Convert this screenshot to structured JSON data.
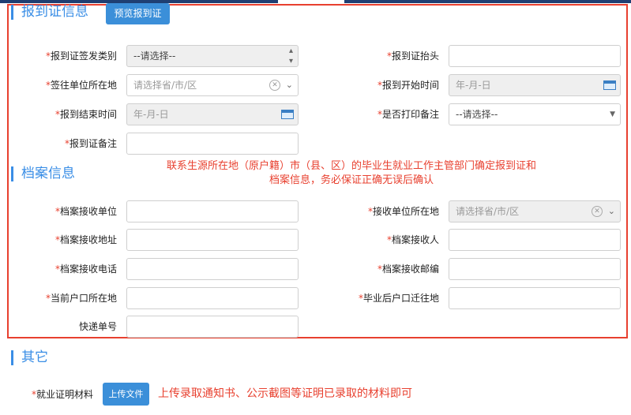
{
  "section1": {
    "title": "报到证信息",
    "preview_button": "预览报到证"
  },
  "section2": {
    "title": "档案信息"
  },
  "section3": {
    "title": "其它"
  },
  "fields": {
    "issue_type": {
      "label": "报到证签发类别",
      "value": "--请选择--"
    },
    "header": {
      "label": "报到证抬头",
      "value": ""
    },
    "unit_location": {
      "label": "签往单位所在地",
      "placeholder": "请选择省/市/区"
    },
    "start_time": {
      "label": "报到开始时间",
      "placeholder": "年-月-日"
    },
    "end_time": {
      "label": "报到结束时间",
      "placeholder": "年-月-日"
    },
    "print_note": {
      "label": "是否打印备注",
      "value": "--请选择--"
    },
    "remark": {
      "label": "报到证备注",
      "value": ""
    },
    "archive_unit": {
      "label": "档案接收单位",
      "value": ""
    },
    "receive_unit_location": {
      "label": "接收单位所在地",
      "placeholder": "请选择省/市/区"
    },
    "archive_address": {
      "label": "档案接收地址",
      "value": ""
    },
    "archive_receiver": {
      "label": "档案接收人",
      "value": ""
    },
    "archive_phone": {
      "label": "档案接收电话",
      "value": ""
    },
    "archive_postcode": {
      "label": "档案接收邮编",
      "value": ""
    },
    "current_hukou": {
      "label": "当前户口所在地",
      "value": ""
    },
    "post_grad_hukou": {
      "label": "毕业后户口迁往地",
      "value": ""
    },
    "express_no": {
      "label": "快递单号",
      "value": ""
    },
    "employment_proof": {
      "label": "就业证明材料",
      "button": "上传文件"
    }
  },
  "notes": {
    "archive_note_line1": "联系生源所在地（原户籍）市（县、区）的毕业生就业工作主管部门确定报到证和",
    "archive_note_line2": "档案信息，务必保证正确无误后确认",
    "upload_note": "上传录取通知书、公示截图等证明已录取的材料即可"
  },
  "required_mark": "*"
}
